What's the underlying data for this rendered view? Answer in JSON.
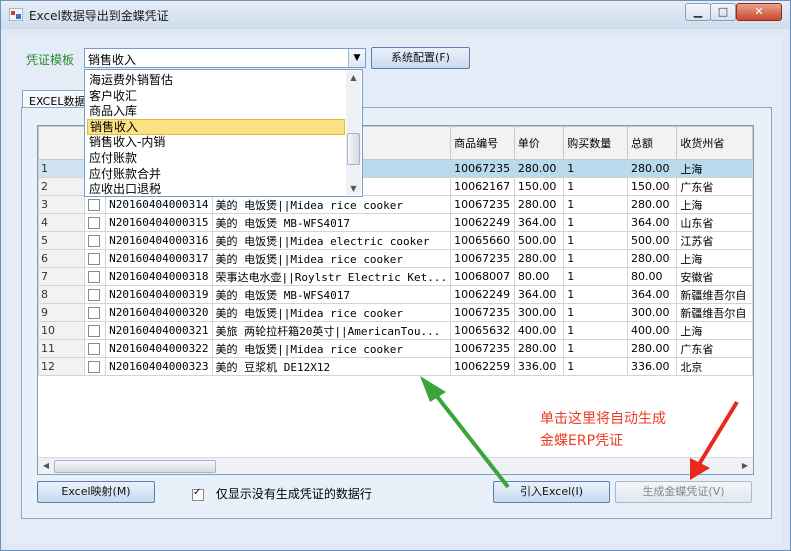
{
  "window": {
    "title": "Excel数据导出到金蝶凭证",
    "minimize_glyph": "▁",
    "maximize_glyph": "□",
    "close_glyph": "✕"
  },
  "template": {
    "label": "凭证模板",
    "selected": "销售收入",
    "options": [
      "海运费外销暂估",
      "客户收汇",
      "商品入库",
      "销售收入",
      "销售收入-内销",
      "应付账款",
      "应付账款合并",
      "应收出口退税"
    ],
    "highlighted_index": 3
  },
  "buttons": {
    "system_config": "系统配置(F)",
    "excel_mapping": "Excel映射(M)",
    "import_excel": "引入Excel(I)",
    "generate_voucher": "生成金蝶凭证(V)"
  },
  "tab": {
    "label": "EXCEL数据"
  },
  "grid": {
    "columns": [
      "",
      "",
      "",
      "",
      "商品编号",
      "单价",
      "购买数量",
      "总额",
      "收货州省"
    ],
    "rows": [
      {
        "num": "1",
        "order": "",
        "product": "cooker",
        "sku": "10067235",
        "price": "280.00",
        "qty": "1",
        "total": "280.00",
        "province": "上海",
        "selected": true
      },
      {
        "num": "2",
        "order": "",
        "product": "e Computer...",
        "sku": "10062167",
        "price": "150.00",
        "qty": "1",
        "total": "150.00",
        "province": "广东省"
      },
      {
        "num": "3",
        "order": "N20160404000314",
        "product": "美的 电饭煲||Midea rice cooker",
        "sku": "10067235",
        "price": "280.00",
        "qty": "1",
        "total": "280.00",
        "province": "上海"
      },
      {
        "num": "4",
        "order": "N20160404000315",
        "product": "美的 电饭煲 MB-WFS4017",
        "sku": "10062249",
        "price": "364.00",
        "qty": "1",
        "total": "364.00",
        "province": "山东省"
      },
      {
        "num": "5",
        "order": "N20160404000316",
        "product": "美的 电饭煲||Midea electric cooker",
        "sku": "10065660",
        "price": "500.00",
        "qty": "1",
        "total": "500.00",
        "province": "江苏省"
      },
      {
        "num": "6",
        "order": "N20160404000317",
        "product": "美的 电饭煲||Midea rice cooker",
        "sku": "10067235",
        "price": "280.00",
        "qty": "1",
        "total": "280.00",
        "province": "上海"
      },
      {
        "num": "7",
        "order": "N20160404000318",
        "product": "荣事达电水壶||Roylstr Electric Ket...",
        "sku": "10068007",
        "price": "80.00",
        "qty": "1",
        "total": "80.00",
        "province": "安徽省"
      },
      {
        "num": "8",
        "order": "N20160404000319",
        "product": "美的 电饭煲 MB-WFS4017",
        "sku": "10062249",
        "price": "364.00",
        "qty": "1",
        "total": "364.00",
        "province": "新疆维吾尔自"
      },
      {
        "num": "9",
        "order": "N20160404000320",
        "product": "美的 电饭煲||Midea rice cooker",
        "sku": "10067235",
        "price": "300.00",
        "qty": "1",
        "total": "300.00",
        "province": "新疆维吾尔自"
      },
      {
        "num": "10",
        "order": "N20160404000321",
        "product": "美旅 两轮拉杆箱20英寸||AmericanTou...",
        "sku": "10065632",
        "price": "400.00",
        "qty": "1",
        "total": "400.00",
        "province": "上海"
      },
      {
        "num": "11",
        "order": "N20160404000322",
        "product": "美的 电饭煲||Midea rice cooker",
        "sku": "10067235",
        "price": "280.00",
        "qty": "1",
        "total": "280.00",
        "province": "广东省"
      },
      {
        "num": "12",
        "order": "N20160404000323",
        "product": "美的 豆浆机 DE12X12",
        "sku": "10062259",
        "price": "336.00",
        "qty": "1",
        "total": "336.00",
        "province": "北京"
      }
    ]
  },
  "filter": {
    "label": "仅显示没有生成凭证的数据行",
    "checked": true
  },
  "annotation": {
    "line1": "单击这里将自动生成",
    "line2": "金蝶ERP凭证"
  },
  "colors": {
    "annotation": "#ee3b24",
    "arrow_green": "#3aa53a",
    "arrow_red": "#e8291c",
    "selection": "#b9d9ec",
    "highlight": "#f9e184"
  }
}
